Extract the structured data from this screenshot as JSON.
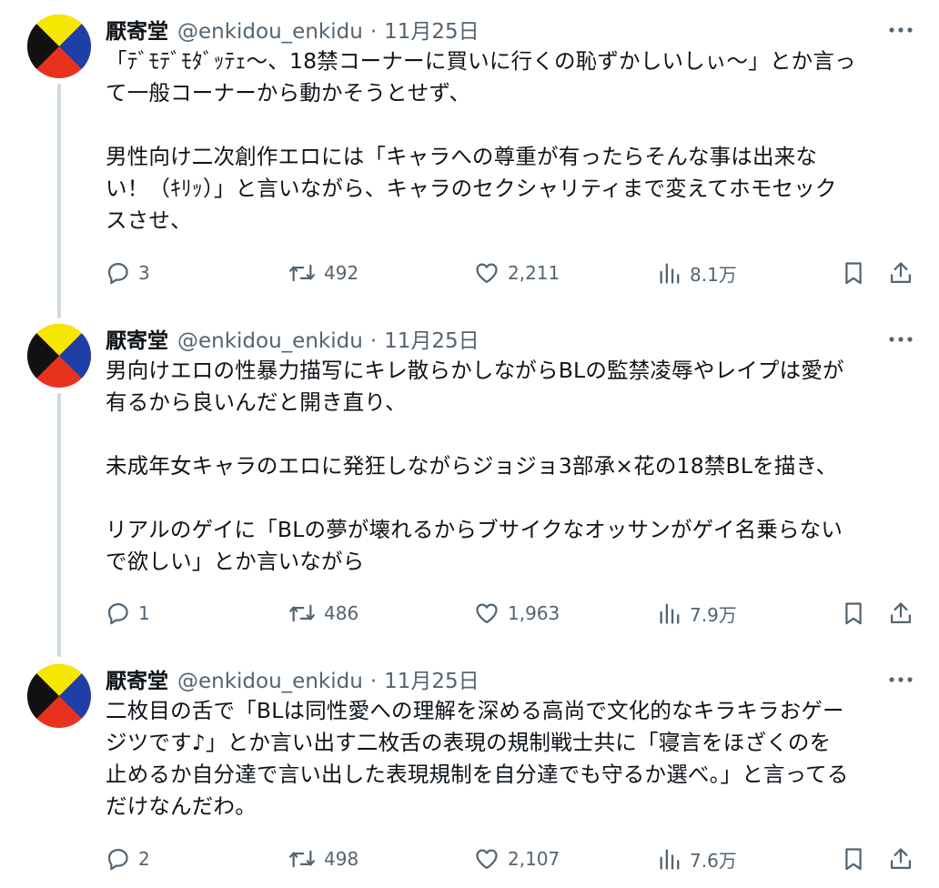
{
  "tweets": [
    {
      "author_name": "厭寄堂",
      "handle": "@enkidou_enkidu",
      "separator": "·",
      "date": "11月25日",
      "more_icon": "more-horizontal-icon",
      "text": "「ﾃﾞﾓﾃﾞﾓﾀﾞｯﾃｪ〜、18禁コーナーに買いに行くの恥ずかしいしぃ〜」とか言っ\nて一般コーナーから動かそうとせず、\n\n男性向け二次創作エロには「キャラへの尊重が有ったらそんな事は出来な\nい！（ｷﾘｯ）」と言いながら、キャラのセクシャリティまで変えてホモセック\nスさせ、",
      "replies": "3",
      "retweets": "492",
      "likes": "2,211",
      "views": "8.1万"
    },
    {
      "author_name": "厭寄堂",
      "handle": "@enkidou_enkidu",
      "separator": "·",
      "date": "11月25日",
      "more_icon": "more-horizontal-icon",
      "text": "男向けエロの性暴力描写にキレ散らかしながらBLの監禁凌辱やレイプは愛が\n有るから良いんだと開き直り、\n\n未成年女キャラのエロに発狂しながらジョジョ3部承×花の18禁BLを描き、\n\nリアルのゲイに「BLの夢が壊れるからブサイクなオッサンがゲイ名乗らない\nで欲しい」とか言いながら",
      "replies": "1",
      "retweets": "486",
      "likes": "1,963",
      "views": "7.9万"
    },
    {
      "author_name": "厭寄堂",
      "handle": "@enkidou_enkidu",
      "separator": "·",
      "date": "11月25日",
      "more_icon": "more-horizontal-icon",
      "text": "二枚目の舌で「BLは同性愛への理解を深める高尚で文化的なキラキラおゲー\nジツです♪」とか言い出す二枚舌の表現の規制戦士共に「寝言をほざくのを\n止めるか自分達で言い出した表現規制を自分達でも守るか選べ。」と言ってる\nだけなんだわ。",
      "replies": "2",
      "retweets": "498",
      "likes": "2,107",
      "views": "7.6万"
    }
  ],
  "icons": {
    "reply": "reply-bubble-icon",
    "retweet": "retweet-arrows-icon",
    "like": "heart-icon",
    "views": "views-bar-chart-icon",
    "bookmark": "bookmark-icon",
    "share": "share-upload-icon"
  },
  "colors": {
    "text": "#0f1419",
    "secondary": "#536471",
    "thread_line": "#cfd9de",
    "avatar_yellow": "#f7e600",
    "avatar_blue": "#1f3fa8",
    "avatar_red": "#e8321e",
    "avatar_black": "#111111"
  }
}
